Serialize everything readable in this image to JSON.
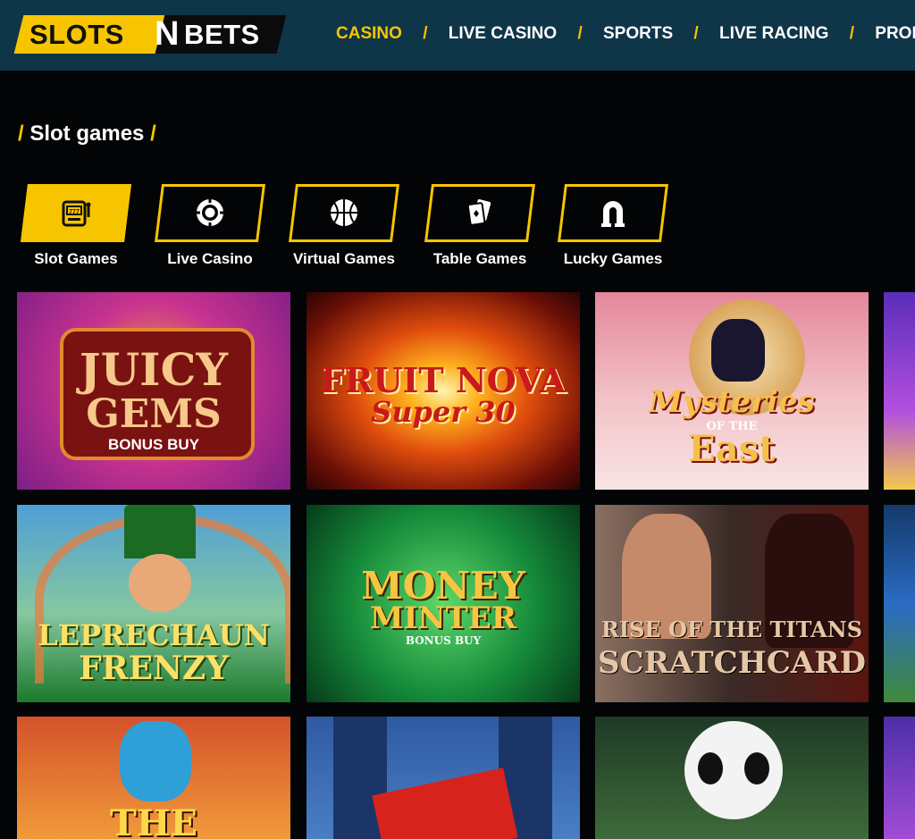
{
  "brand": {
    "part1": "SLOTS",
    "part2": "N",
    "part3": "BETS"
  },
  "nav": [
    {
      "label": "CASINO",
      "active": true
    },
    {
      "label": "LIVE CASINO",
      "active": false
    },
    {
      "label": "SPORTS",
      "active": false
    },
    {
      "label": "LIVE RACING",
      "active": false
    },
    {
      "label": "PROMOTI",
      "active": false
    }
  ],
  "nav_separator": "/",
  "breadcrumb": {
    "slash": "/",
    "label": "Slot games"
  },
  "categories": [
    {
      "label": "Slot Games",
      "icon": "slot-machine-icon",
      "active": true
    },
    {
      "label": "Live Casino",
      "icon": "roulette-chip-icon",
      "active": false
    },
    {
      "label": "Virtual Games",
      "icon": "basketball-icon",
      "active": false
    },
    {
      "label": "Table Games",
      "icon": "playing-cards-icon",
      "active": false
    },
    {
      "label": "Lucky Games",
      "icon": "horseshoe-icon",
      "active": false
    }
  ],
  "games": [
    {
      "line1": "JUICY",
      "line2": "GEMS",
      "line3": "BONUS BUY"
    },
    {
      "line1": "FRUIT NOVA",
      "line2": "Super 30",
      "line3": ""
    },
    {
      "line1": "Mysteries",
      "line2": "OF THE",
      "line3": "East"
    },
    {
      "line1": "LEPRECHAUN",
      "line2": "FRENZY",
      "line3": ""
    },
    {
      "line1": "MONEY",
      "line2": "MINTER",
      "line3": "BONUS BUY"
    },
    {
      "line1": "RISE OF THE TITANS",
      "line2": "SCRATCHCARD",
      "line3": ""
    },
    {
      "line1": "THE",
      "line2": "",
      "line3": ""
    },
    {
      "line1": "",
      "line2": "",
      "line3": ""
    },
    {
      "line1": "",
      "line2": "",
      "line3": ""
    }
  ],
  "colors": {
    "accent": "#f7c500",
    "header_bg": "#0f3548",
    "page_bg": "#030406"
  }
}
